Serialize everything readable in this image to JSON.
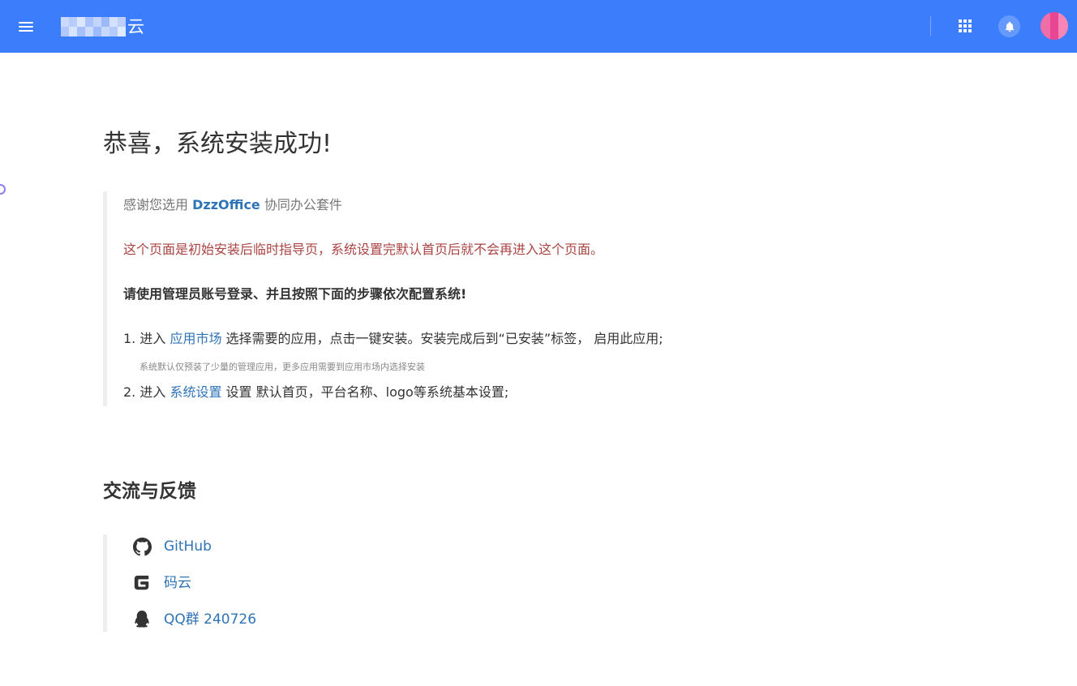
{
  "header": {
    "app_name_suffix": "云",
    "menu_icon": "hamburger-menu-icon",
    "apps_icon": "grid-apps-icon",
    "notification_icon": "bell-icon",
    "avatar_colors": [
      "#f06ea8",
      "#e84592",
      "#f386b6"
    ],
    "background_color": "#3c7dfb"
  },
  "main": {
    "title": "恭喜，系统安装成功!",
    "thanks": {
      "prefix": "感谢您选用 ",
      "brand": "DzzOffice",
      "suffix": " 协同办公套件"
    },
    "warning": "这个页面是初始安装后临时指导页，系统设置完默认首页后就不会再进入这个页面。",
    "instruction": "请使用管理员账号登录、并且按照下面的步骤依次配置系统!",
    "steps": [
      {
        "prefix": "1. 进入 ",
        "link": "应用市场",
        "suffix": " 选择需要的应用，点击一键安装。安装完成后到“已安装”标签， 启用此应用;"
      },
      {
        "prefix": "2. 进入 ",
        "link": "系统设置",
        "suffix": " 设置 默认首页，平台名称、logo等系统基本设置;"
      }
    ],
    "step1_hint": "系统默认仅预装了少量的管理应用，更多应用需要到应用市场内选择安装",
    "feedback_title": "交流与反馈",
    "feedback_links": [
      {
        "label": "GitHub",
        "icon": "github-icon"
      },
      {
        "label": "码云",
        "icon": "gitee-icon"
      },
      {
        "label": "QQ群 240726",
        "icon": "qq-icon"
      }
    ]
  },
  "colors": {
    "link": "#2f73b7",
    "warning": "#a94442",
    "muted": "#777777",
    "quote_border": "#eeeeee"
  }
}
